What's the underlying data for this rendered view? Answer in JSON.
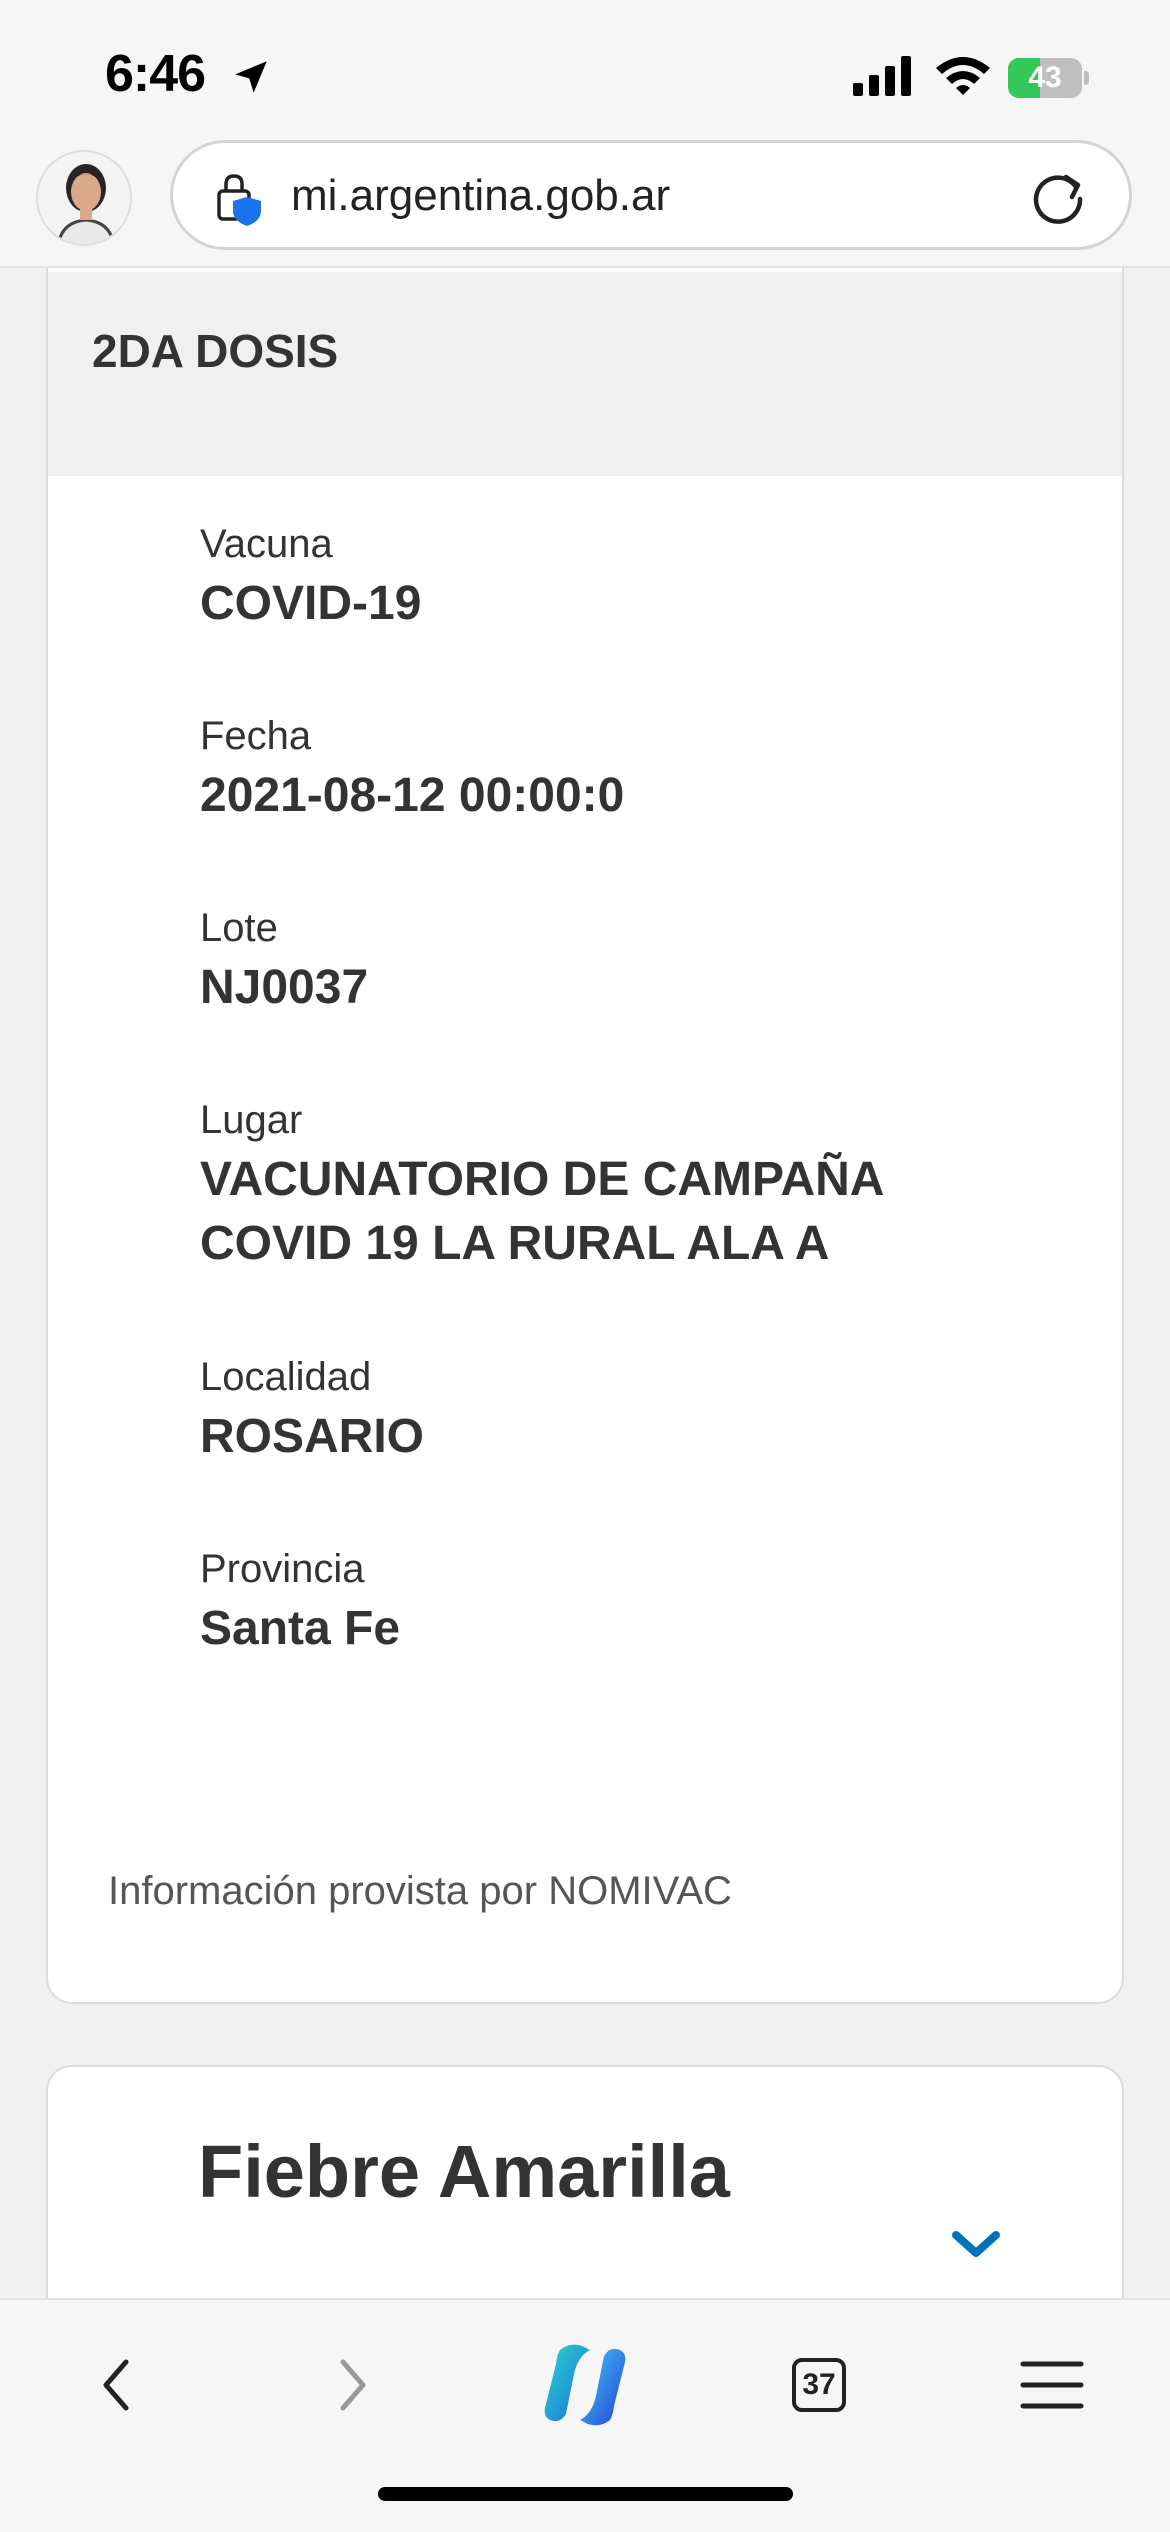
{
  "status_bar": {
    "time": "6:46",
    "battery_percent": "43",
    "battery_level": 0.43,
    "icons": [
      "location-arrow-icon",
      "cellular-signal-icon",
      "wifi-icon",
      "battery-charging-icon"
    ]
  },
  "browser": {
    "url": "mi.argentina.gob.ar",
    "tab_count": "37",
    "icons": [
      "lock-shield-icon",
      "reload-icon",
      "back-icon",
      "forward-icon",
      "copilot-icon",
      "menu-icon"
    ]
  },
  "dose_card": {
    "title": "2DA DOSIS",
    "fields": [
      {
        "label": "Vacuna",
        "value": "COVID-19"
      },
      {
        "label": "Fecha",
        "value": "2021-08-12 00:00:0"
      },
      {
        "label": "Lote",
        "value": "NJ0037"
      },
      {
        "label": "Lugar",
        "value_lines": [
          "VACUNATORIO DE CAMPAÑA",
          "COVID 19 LA RURAL ALA A"
        ]
      },
      {
        "label": "Localidad",
        "value": "ROSARIO"
      },
      {
        "label": "Provincia",
        "value": "Santa Fe"
      }
    ],
    "source_note": "Información provista por NOMIVAC"
  },
  "next_card": {
    "title": "Fiebre Amarilla",
    "icon": "chevron-down-icon"
  },
  "colors": {
    "accent_blue": "#0072bb",
    "battery_green": "#34c759",
    "text_dark": "#333333"
  }
}
